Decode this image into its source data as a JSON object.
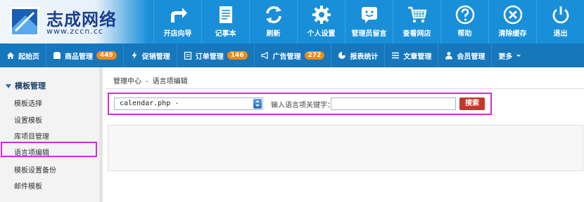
{
  "logo": {
    "title": "志成网络",
    "url": "www.zccn.cc"
  },
  "top_nav": [
    {
      "label": "开店向导",
      "icon": "share-arrow-icon"
    },
    {
      "label": "记事本",
      "icon": "notepad-icon"
    },
    {
      "label": "刷新",
      "icon": "refresh-icon"
    },
    {
      "label": "个人设置",
      "icon": "gear-icon"
    },
    {
      "label": "管理员留言",
      "icon": "chat-smile-icon"
    },
    {
      "label": "查看网店",
      "icon": "cart-icon"
    },
    {
      "label": "帮助",
      "icon": "help-icon"
    },
    {
      "label": "清除缓存",
      "icon": "close-circle-icon"
    },
    {
      "label": "退出",
      "icon": "power-icon"
    }
  ],
  "sub_nav": [
    {
      "label": "起始页",
      "icon": "home-icon",
      "badge": ""
    },
    {
      "label": "商品管理",
      "icon": "folder-icon",
      "badge": "449"
    },
    {
      "label": "促销管理",
      "icon": "bolt-icon",
      "badge": ""
    },
    {
      "label": "订单管理",
      "icon": "clipboard-icon",
      "badge": "146"
    },
    {
      "label": "广告管理",
      "icon": "megaphone-icon",
      "badge": "272"
    },
    {
      "label": "报表统计",
      "icon": "pie-chart-icon",
      "badge": ""
    },
    {
      "label": "文章管理",
      "icon": "list-icon",
      "badge": ""
    },
    {
      "label": "会员管理",
      "icon": "users-icon",
      "badge": ""
    },
    {
      "label": "更多",
      "icon": "caret-down-icon",
      "badge": ""
    }
  ],
  "sidebar": {
    "title": "模板管理",
    "items": [
      "模板选择",
      "设置模板",
      "库项目管理",
      "语言项编辑",
      "模板设置备份",
      "邮件模板"
    ],
    "active_index": 3
  },
  "breadcrumb": {
    "root": "管理中心",
    "separator": "-",
    "current": "语言项编辑"
  },
  "search": {
    "select_value": "calendar.php -",
    "keyword_label": "输入语言项关键字：",
    "keyword_value": "",
    "button_label": "搜索"
  },
  "colors": {
    "header_blue": "#1a8fd9",
    "subnav_blue": "#1677bd",
    "badge_orange": "#ef8a14",
    "highlight_magenta": "#cc33cc",
    "search_button_red": "#c0392b"
  }
}
